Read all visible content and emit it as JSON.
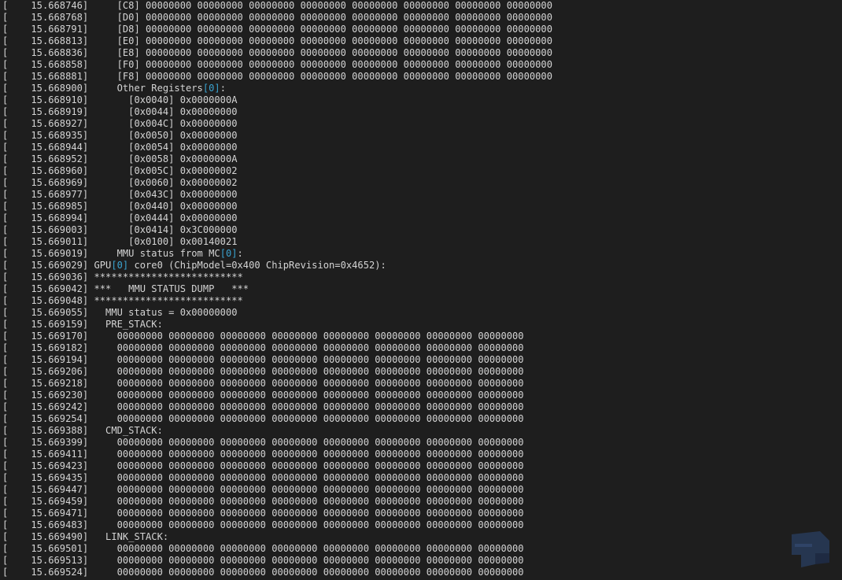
{
  "terminal": {
    "lines": [
      [
        "[    15.668746]     [C8] 00000000 00000000 00000000 00000000 00000000 00000000 00000000 00000000"
      ],
      [
        "[    15.668768]     [D0] 00000000 00000000 00000000 00000000 00000000 00000000 00000000 00000000"
      ],
      [
        "[    15.668791]     [D8] 00000000 00000000 00000000 00000000 00000000 00000000 00000000 00000000"
      ],
      [
        "[    15.668813]     [E0] 00000000 00000000 00000000 00000000 00000000 00000000 00000000 00000000"
      ],
      [
        "[    15.668836]     [E8] 00000000 00000000 00000000 00000000 00000000 00000000 00000000 00000000"
      ],
      [
        "[    15.668858]     [F0] 00000000 00000000 00000000 00000000 00000000 00000000 00000000 00000000"
      ],
      [
        "[    15.668881]     [F8] 00000000 00000000 00000000 00000000 00000000 00000000 00000000 00000000"
      ],
      [
        "[    15.668900]     Other Registers",
        {
          "hl": "[0]"
        },
        ":"
      ],
      [
        "[    15.668910]       [0x0040] 0x0000000A"
      ],
      [
        "[    15.668919]       [0x0044] 0x00000000"
      ],
      [
        "[    15.668927]       [0x004C] 0x00000000"
      ],
      [
        "[    15.668935]       [0x0050] 0x00000000"
      ],
      [
        "[    15.668944]       [0x0054] 0x00000000"
      ],
      [
        "[    15.668952]       [0x0058] 0x0000000A"
      ],
      [
        "[    15.668960]       [0x005C] 0x00000002"
      ],
      [
        "[    15.668969]       [0x0060] 0x00000002"
      ],
      [
        "[    15.668977]       [0x043C] 0x00000000"
      ],
      [
        "[    15.668985]       [0x0440] 0x00000000"
      ],
      [
        "[    15.668994]       [0x0444] 0x00000000"
      ],
      [
        "[    15.669003]       [0x0414] 0x3C000000"
      ],
      [
        "[    15.669011]       [0x0100] 0x00140021"
      ],
      [
        "[    15.669019]     MMU status from MC",
        {
          "hl": "[0]"
        },
        ":"
      ],
      [
        "[    15.669029] GPU",
        {
          "hl": "[0]"
        },
        " core0 (ChipModel=0x400 ChipRevision=0x4652):"
      ],
      [
        "[    15.669036] **************************"
      ],
      [
        "[    15.669042] ***   MMU STATUS DUMP   ***"
      ],
      [
        "[    15.669048] **************************"
      ],
      [
        "[    15.669055]   MMU status = 0x00000000"
      ],
      [
        "[    15.669159]   PRE_STACK:"
      ],
      [
        "[    15.669170]     00000000 00000000 00000000 00000000 00000000 00000000 00000000 00000000"
      ],
      [
        "[    15.669182]     00000000 00000000 00000000 00000000 00000000 00000000 00000000 00000000"
      ],
      [
        "[    15.669194]     00000000 00000000 00000000 00000000 00000000 00000000 00000000 00000000"
      ],
      [
        "[    15.669206]     00000000 00000000 00000000 00000000 00000000 00000000 00000000 00000000"
      ],
      [
        "[    15.669218]     00000000 00000000 00000000 00000000 00000000 00000000 00000000 00000000"
      ],
      [
        "[    15.669230]     00000000 00000000 00000000 00000000 00000000 00000000 00000000 00000000"
      ],
      [
        "[    15.669242]     00000000 00000000 00000000 00000000 00000000 00000000 00000000 00000000"
      ],
      [
        "[    15.669254]     00000000 00000000 00000000 00000000 00000000 00000000 00000000 00000000"
      ],
      [
        "[    15.669388]   CMD_STACK:"
      ],
      [
        "[    15.669399]     00000000 00000000 00000000 00000000 00000000 00000000 00000000 00000000"
      ],
      [
        "[    15.669411]     00000000 00000000 00000000 00000000 00000000 00000000 00000000 00000000"
      ],
      [
        "[    15.669423]     00000000 00000000 00000000 00000000 00000000 00000000 00000000 00000000"
      ],
      [
        "[    15.669435]     00000000 00000000 00000000 00000000 00000000 00000000 00000000 00000000"
      ],
      [
        "[    15.669447]     00000000 00000000 00000000 00000000 00000000 00000000 00000000 00000000"
      ],
      [
        "[    15.669459]     00000000 00000000 00000000 00000000 00000000 00000000 00000000 00000000"
      ],
      [
        "[    15.669471]     00000000 00000000 00000000 00000000 00000000 00000000 00000000 00000000"
      ],
      [
        "[    15.669483]     00000000 00000000 00000000 00000000 00000000 00000000 00000000 00000000"
      ],
      [
        "[    15.669490]   LINK_STACK:"
      ],
      [
        "[    15.669501]     00000000 00000000 00000000 00000000 00000000 00000000 00000000 00000000"
      ],
      [
        "[    15.669513]     00000000 00000000 00000000 00000000 00000000 00000000 00000000 00000000"
      ],
      [
        "[    15.669524]     00000000 00000000 00000000 00000000 00000000 00000000 00000000 00000000"
      ]
    ]
  },
  "colors": {
    "background": "#1e1e1e",
    "text": "#d4d4d4",
    "highlight": "#3aa3d0"
  },
  "watermark": {
    "icon": "watermark-logo-icon"
  }
}
